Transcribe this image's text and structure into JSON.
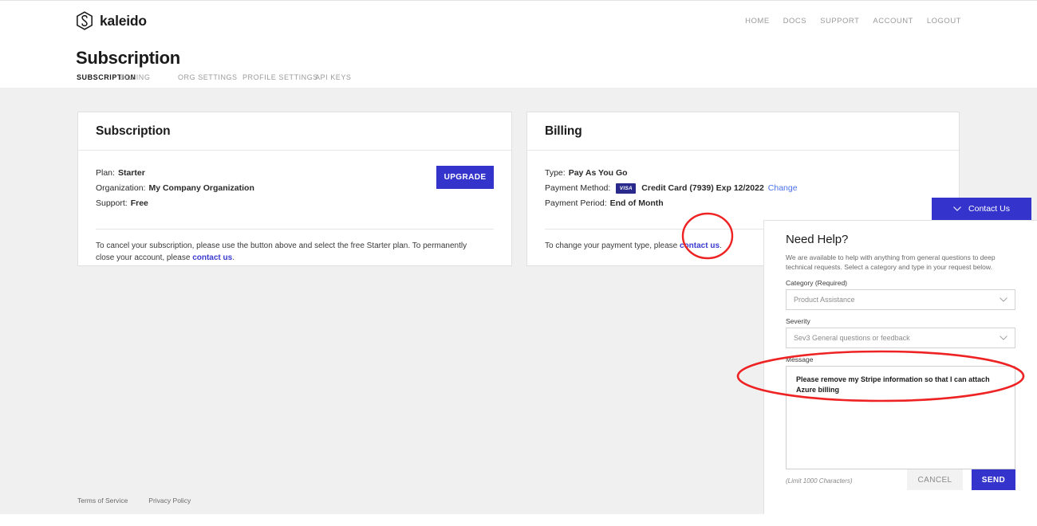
{
  "brand": {
    "name": "kaleido",
    "logo_icon": "kaleido-hexagon-logo"
  },
  "top_nav": [
    {
      "label": "HOME"
    },
    {
      "label": "DOCS"
    },
    {
      "label": "SUPPORT"
    },
    {
      "label": "ACCOUNT"
    },
    {
      "label": "LOGOUT"
    }
  ],
  "page": {
    "title": "Subscription"
  },
  "tabs": [
    {
      "label": "SUBSCRIPTION",
      "active": true
    },
    {
      "label": "BILLING",
      "active": false
    },
    {
      "label": "ORG SETTINGS",
      "active": false
    },
    {
      "label": "PROFILE SETTINGS",
      "active": false
    },
    {
      "label": "API KEYS",
      "active": false
    }
  ],
  "subscription_card": {
    "title": "Subscription",
    "plan_label": "Plan:",
    "plan_value": "Starter",
    "organization_label": "Organization:",
    "organization_value": "My Company Organization",
    "support_label": "Support:",
    "support_value": "Free",
    "upgrade_label": "UPGRADE",
    "note_prefix": "To cancel your subscription, please use the button above and select the free Starter plan. To permanently close your account, please ",
    "note_link": "contact us",
    "note_suffix": "."
  },
  "billing_card": {
    "title": "Billing",
    "type_label": "Type:",
    "type_value": "Pay As You Go",
    "payment_method_label": "Payment Method:",
    "card_brand": "VISA",
    "payment_method_value": "Credit Card (7939) Exp 12/2022",
    "change_link": "Change",
    "payment_period_label": "Payment Period:",
    "payment_period_value": "End of Month",
    "note_prefix": "To change your payment type, please ",
    "note_link": "contact us",
    "note_suffix": "."
  },
  "contact_button": {
    "label": "Contact Us",
    "icon": "chevron-down-icon"
  },
  "help_panel": {
    "title": "Need Help?",
    "description": "We are available to help with anything from general questions to deep technical requests. Select a category and type in your request below.",
    "category_label": "Category  (Required)",
    "category_value": "Product Assistance",
    "severity_label": "Severity",
    "severity_value": "Sev3 General questions or feedback",
    "message_label": "Message",
    "message_value": "Please remove my Stripe information so that I can attach Azure billing",
    "limit_note": "(Limit 1000 Characters)",
    "cancel_label": "CANCEL",
    "send_label": "SEND"
  },
  "footer": [
    {
      "label": "Terms of Service"
    },
    {
      "label": "Privacy Policy"
    }
  ],
  "colors": {
    "accent": "#3434cc",
    "link": "#3a3ad0",
    "annotation": "#ee2222",
    "page_bg": "#f0f0f0"
  }
}
